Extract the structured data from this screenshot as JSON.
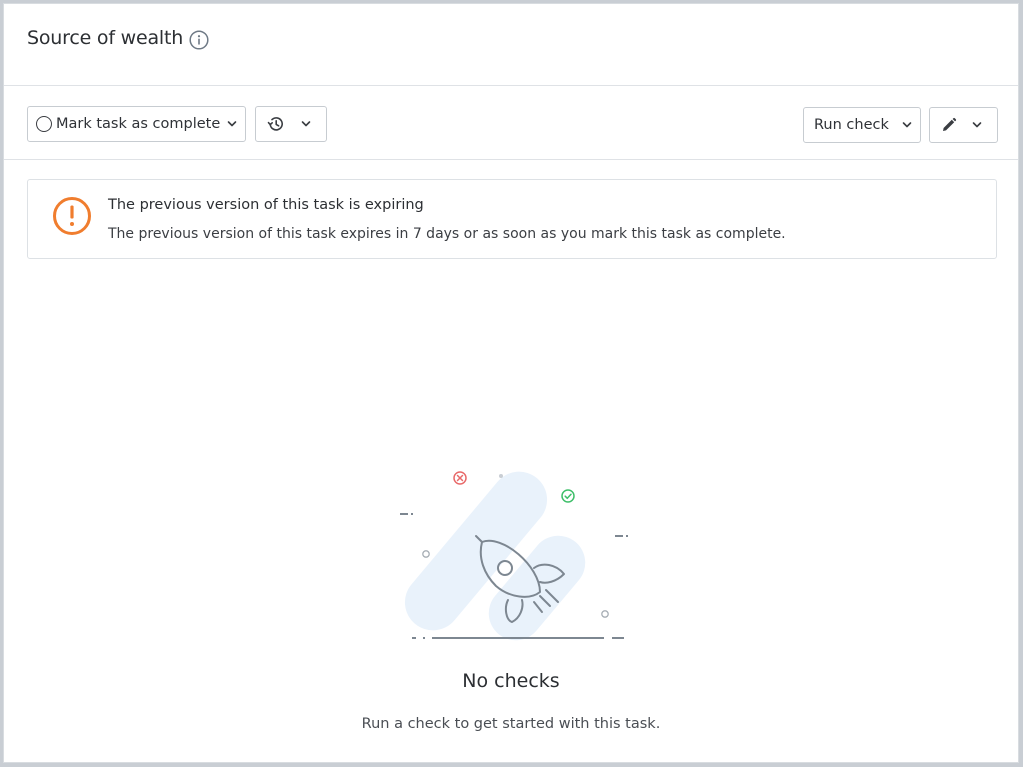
{
  "header": {
    "title": "Source of wealth",
    "info_icon": "info-icon"
  },
  "toolbar": {
    "mark_complete_label": "Mark task as complete",
    "history_icon": "history-icon",
    "run_check_label": "Run check",
    "edit_icon": "pencil-icon"
  },
  "alert": {
    "icon": "exclamation-circle-icon",
    "title": "The previous version of this task is expiring",
    "body": "The previous version of this task expires in 7 days or as soon as you mark this task as complete."
  },
  "empty_state": {
    "illustration": "rocket-illustration",
    "title": "No checks",
    "subtitle": "Run a check to get started with this task."
  },
  "colors": {
    "warning": "#f07d2e",
    "error": "#e86a6a",
    "success": "#3fbf6a",
    "illustration_bg": "#e9f2fb",
    "illustration_line": "#7d8791"
  }
}
